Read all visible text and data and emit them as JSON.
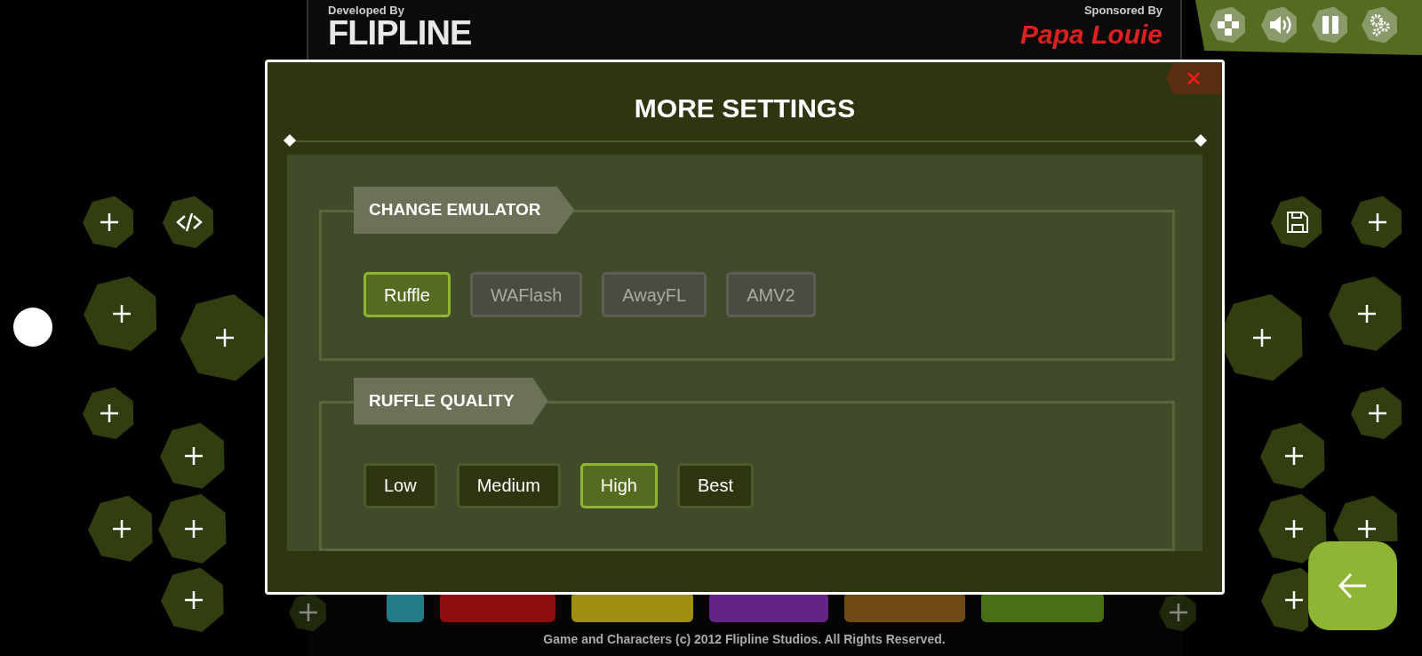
{
  "game_banner": {
    "developer_caption": "Developed By",
    "developer": "FLIPLINE",
    "sponsor_caption": "Sponsored By",
    "sponsor": "Papa Louie"
  },
  "footer": "Game and Characters (c) 2012 Flipline Studios. All Rights Reserved.",
  "dialog": {
    "title": "MORE SETTINGS",
    "close": "✕",
    "sections": [
      {
        "title": "CHANGE EMULATOR",
        "options": [
          {
            "label": "Ruffle",
            "selected": true,
            "disabled": false
          },
          {
            "label": "WAFlash",
            "selected": false,
            "disabled": true
          },
          {
            "label": "AwayFL",
            "selected": false,
            "disabled": true
          },
          {
            "label": "AMV2",
            "selected": false,
            "disabled": true
          }
        ]
      },
      {
        "title": "RUFFLE QUALITY",
        "options": [
          {
            "label": "Low",
            "selected": false,
            "disabled": false
          },
          {
            "label": "Medium",
            "selected": false,
            "disabled": false
          },
          {
            "label": "High",
            "selected": true,
            "disabled": false
          },
          {
            "label": "Best",
            "selected": false,
            "disabled": false
          }
        ]
      }
    ]
  }
}
